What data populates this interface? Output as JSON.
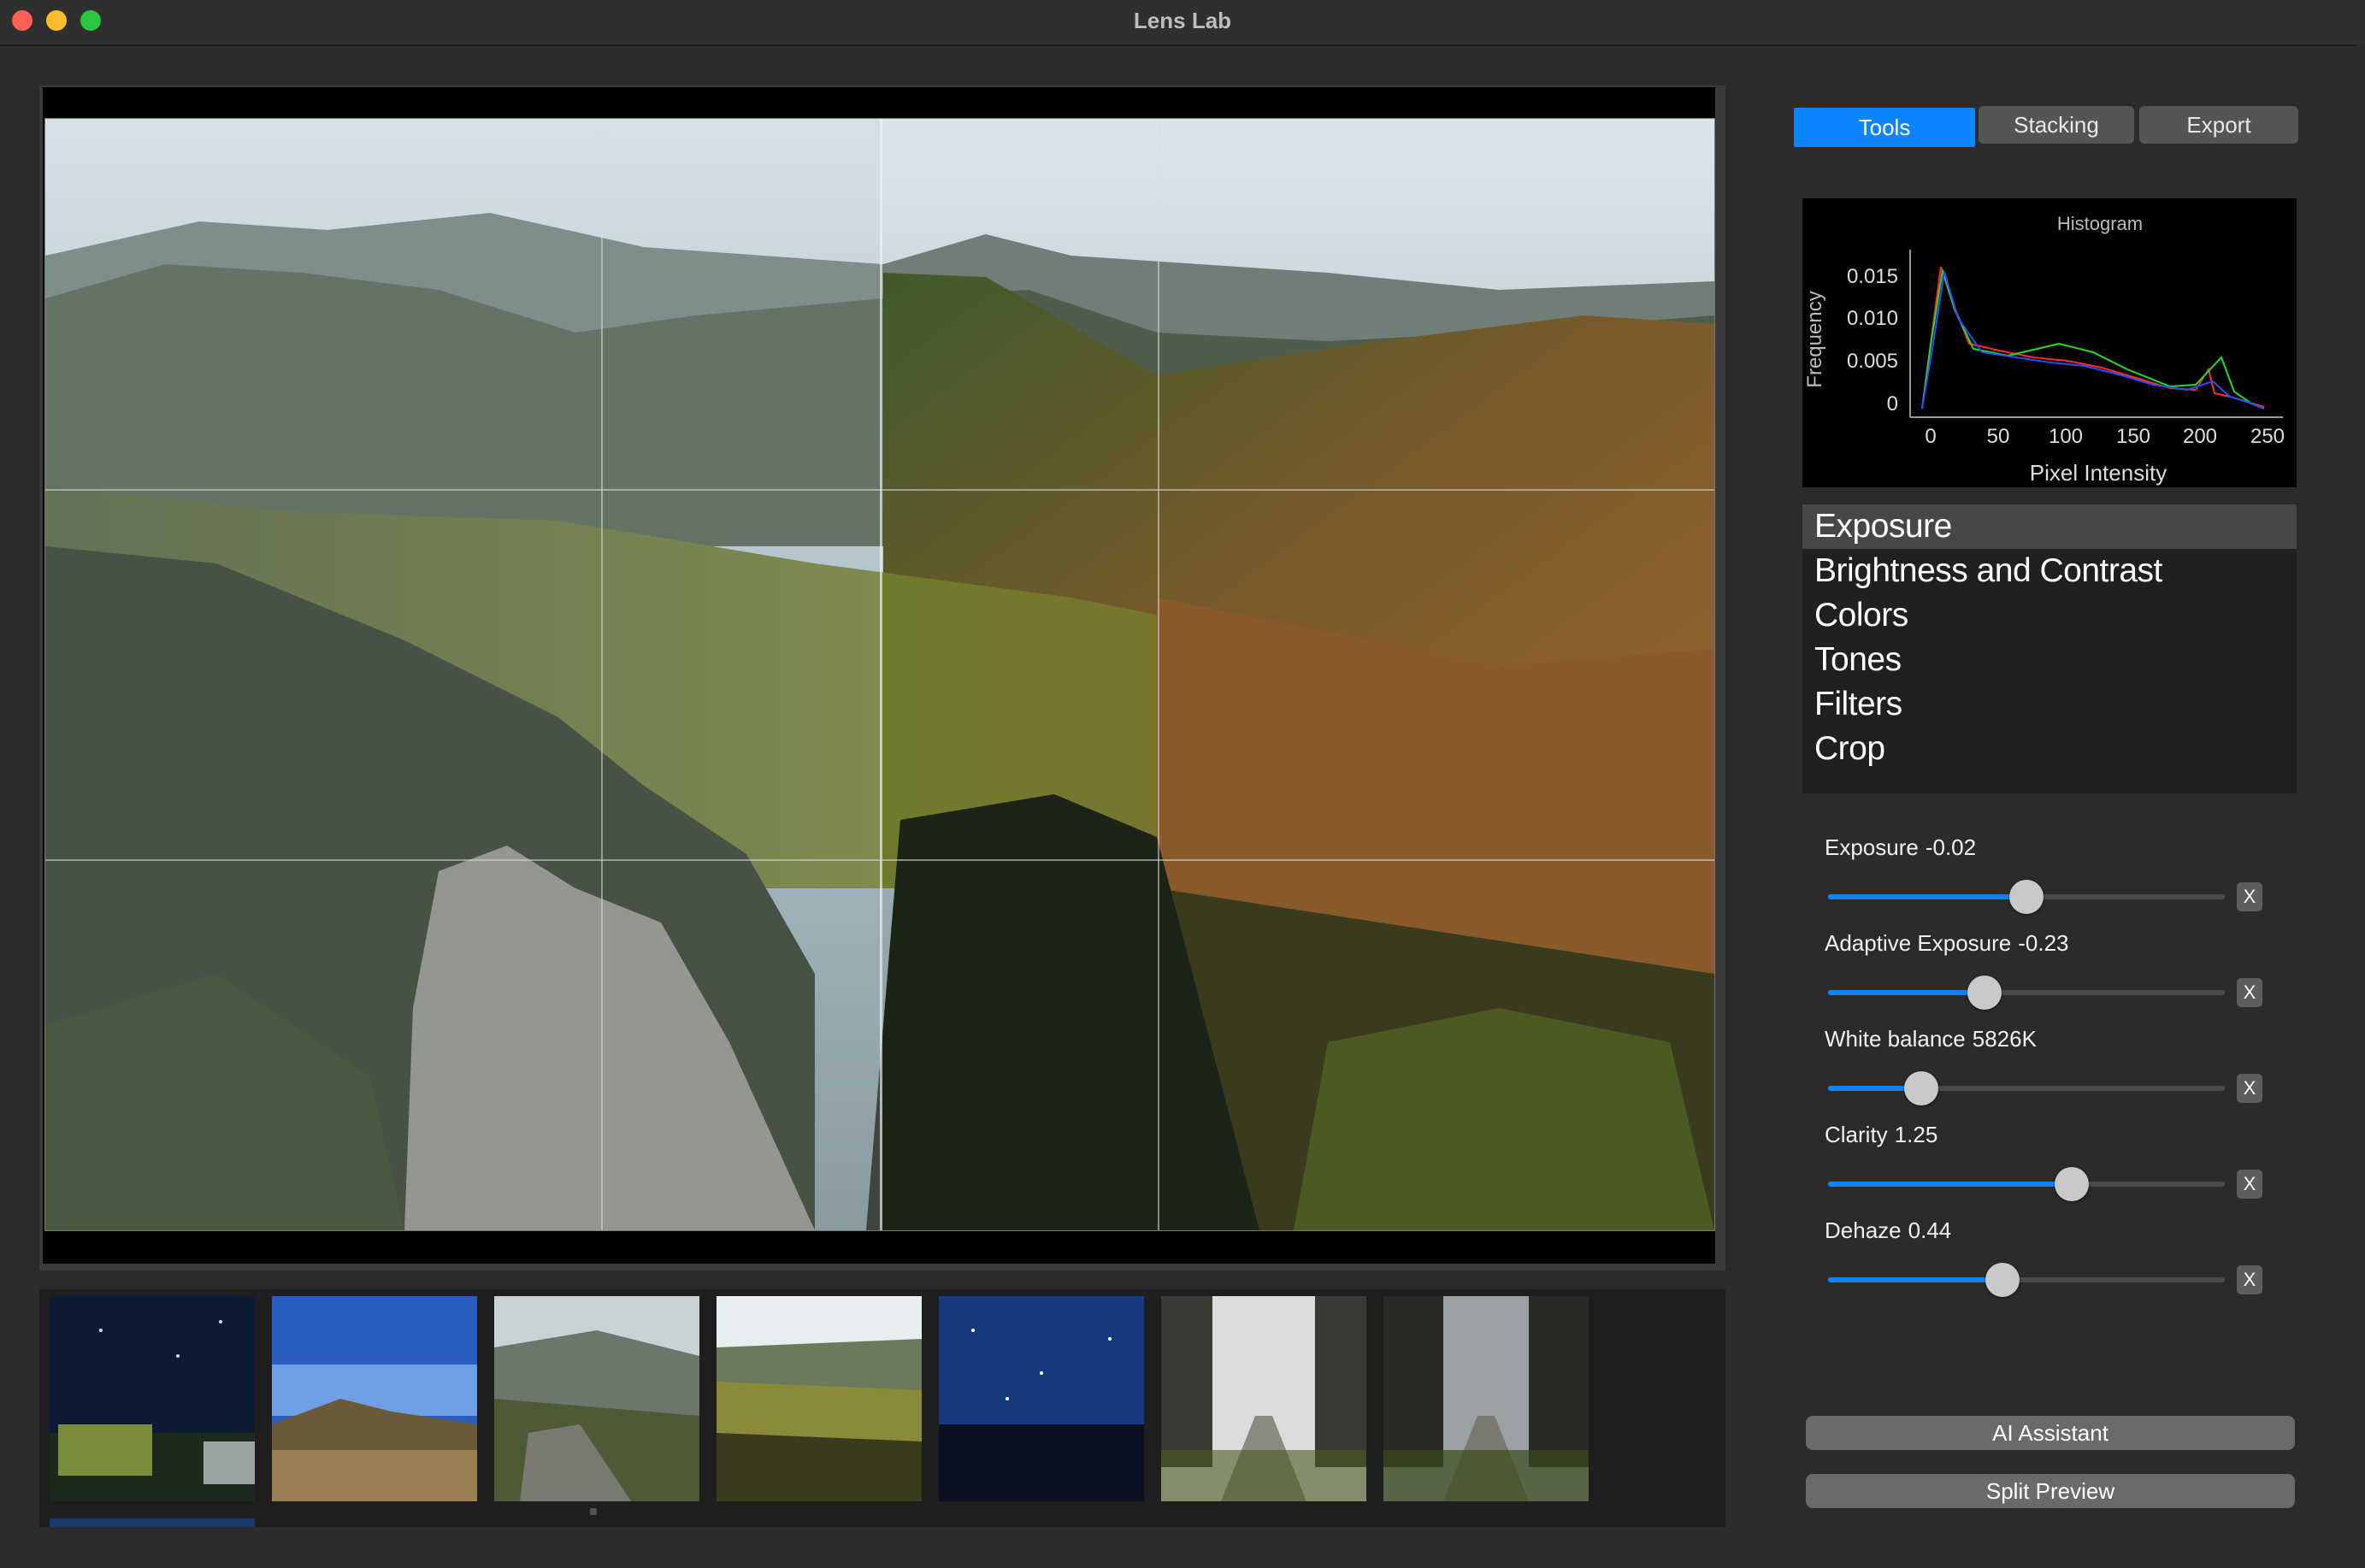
{
  "window": {
    "title": "Lens Lab"
  },
  "tabs": [
    {
      "label": "Tools",
      "active": true
    },
    {
      "label": "Stacking",
      "active": false
    },
    {
      "label": "Export",
      "active": false
    }
  ],
  "histogram": {
    "title": "Histogram",
    "xlabel": "Pixel Intensity",
    "ylabel": "Frequency",
    "xticks": [
      "0",
      "50",
      "100",
      "150",
      "200",
      "250"
    ],
    "yticks": [
      "0",
      "0.005",
      "0.010",
      "0.015"
    ],
    "channel_colors": [
      "#ff2a2a",
      "#22dd22",
      "#2a4bff"
    ]
  },
  "menu": {
    "items": [
      "Exposure",
      "Brightness and Contrast",
      "Colors",
      "Tones",
      "Filters",
      "Crop"
    ],
    "selected": "Exposure"
  },
  "sliders": [
    {
      "name": "Exposure",
      "value": "-0.02",
      "fraction": 0.5
    },
    {
      "name": "Adaptive Exposure",
      "value": "-0.23",
      "fraction": 0.395
    },
    {
      "name": "White balance",
      "value": "5826K",
      "fraction": 0.235
    },
    {
      "name": "Clarity",
      "value": "1.25",
      "fraction": 0.615
    },
    {
      "name": "Dehaze",
      "value": "0.44",
      "fraction": 0.44
    }
  ],
  "reset_label": "X",
  "actions": {
    "ai_assistant": "AI Assistant",
    "split_preview": "Split Preview"
  },
  "filmstrip": {
    "thumbnails": [
      "night-sky-house",
      "blue-sky-hill",
      "valley-hazy",
      "valley-sunny",
      "starry-night-trees",
      "path-trees-bw",
      "path-trees-color"
    ]
  }
}
